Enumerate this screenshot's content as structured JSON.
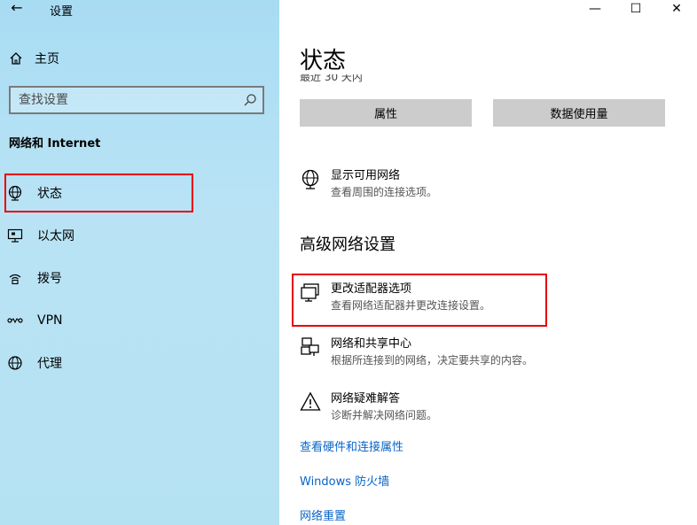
{
  "app": {
    "title": "设置",
    "back_icon": "arrow-left-icon"
  },
  "sidebar": {
    "home_label": "主页",
    "search_placeholder": "查找设置",
    "section_title": "网络和 Internet",
    "items": [
      {
        "label": "状态",
        "icon": "status-globe-icon"
      },
      {
        "label": "以太网",
        "icon": "ethernet-icon"
      },
      {
        "label": "拨号",
        "icon": "dialup-icon"
      },
      {
        "label": "VPN",
        "icon": "vpn-icon"
      },
      {
        "label": "代理",
        "icon": "proxy-globe-icon"
      }
    ]
  },
  "window_controls": {
    "minimize": "—",
    "maximize": "☐",
    "close": "✕"
  },
  "main": {
    "title": "状态",
    "partial_text": "最近 30 天内",
    "buttons": {
      "properties": "属性",
      "data_usage": "数据使用量"
    },
    "show_networks": {
      "title": "显示可用网络",
      "desc": "查看周围的连接选项。"
    },
    "advanced_heading": "高级网络设置",
    "adapter_options": {
      "title": "更改适配器选项",
      "desc": "查看网络适配器并更改连接设置。"
    },
    "sharing_center": {
      "title": "网络和共享中心",
      "desc": "根据所连接到的网络，决定要共享的内容。"
    },
    "troubleshooter": {
      "title": "网络疑难解答",
      "desc": "诊断并解决网络问题。"
    },
    "links": {
      "hardware": "查看硬件和连接属性",
      "firewall": "Windows 防火墙",
      "reset": "网络重置"
    }
  },
  "colors": {
    "sidebar_bg": "#b4e1f4",
    "highlight": "#e60000",
    "link": "#0a64c8",
    "button_bg": "#cccccc"
  }
}
